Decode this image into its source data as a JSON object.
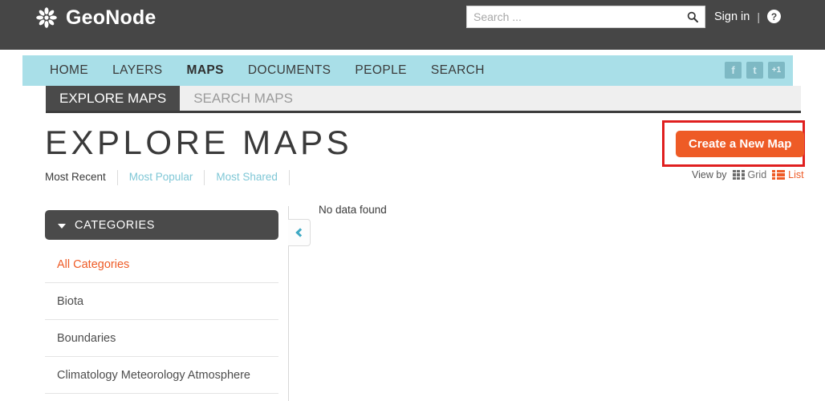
{
  "header": {
    "brand": "GeoNode",
    "brand_icon": "geonode-flower-logo",
    "search": {
      "placeholder": "Search ...",
      "value": "",
      "icon": "search-icon"
    },
    "signin_label": "Sign in",
    "separator": "|",
    "help_icon_label": "?"
  },
  "nav": {
    "items": [
      {
        "label": "HOME",
        "active": false
      },
      {
        "label": "LAYERS",
        "active": false
      },
      {
        "label": "MAPS",
        "active": true
      },
      {
        "label": "DOCUMENTS",
        "active": false
      },
      {
        "label": "PEOPLE",
        "active": false
      },
      {
        "label": "SEARCH",
        "active": false
      }
    ],
    "social": [
      {
        "name": "facebook-icon",
        "glyph": "f"
      },
      {
        "name": "twitter-icon",
        "glyph": "t"
      },
      {
        "name": "google-plus-icon",
        "glyph": "+1"
      }
    ]
  },
  "tabs": [
    {
      "label": "EXPLORE MAPS",
      "active": true
    },
    {
      "label": "SEARCH MAPS",
      "active": false
    }
  ],
  "page": {
    "title": "EXPLORE MAPS",
    "cta_label": "Create a New Map",
    "cta_color": "#ee5b26",
    "highlight_color": "#e01f1f"
  },
  "sort": {
    "options": [
      {
        "label": "Most Recent",
        "active": true
      },
      {
        "label": "Most Popular",
        "active": false
      },
      {
        "label": "Most Shared",
        "active": false
      }
    ]
  },
  "viewby": {
    "label": "View by",
    "options": [
      {
        "label": "Grid",
        "icon": "grid-view-icon",
        "active": false
      },
      {
        "label": "List",
        "icon": "list-view-icon",
        "active": true
      }
    ]
  },
  "sidebar": {
    "panel_title": "CATEGORIES",
    "toggle_icon": "chevron-down-icon",
    "categories": [
      {
        "label": "All Categories",
        "selected": true
      },
      {
        "label": "Biota",
        "selected": false
      },
      {
        "label": "Boundaries",
        "selected": false
      },
      {
        "label": "Climatology Meteorology Atmosphere",
        "selected": false
      }
    ]
  },
  "content": {
    "empty_message": "No data found",
    "collapse_icon": "chevron-left-icon"
  }
}
